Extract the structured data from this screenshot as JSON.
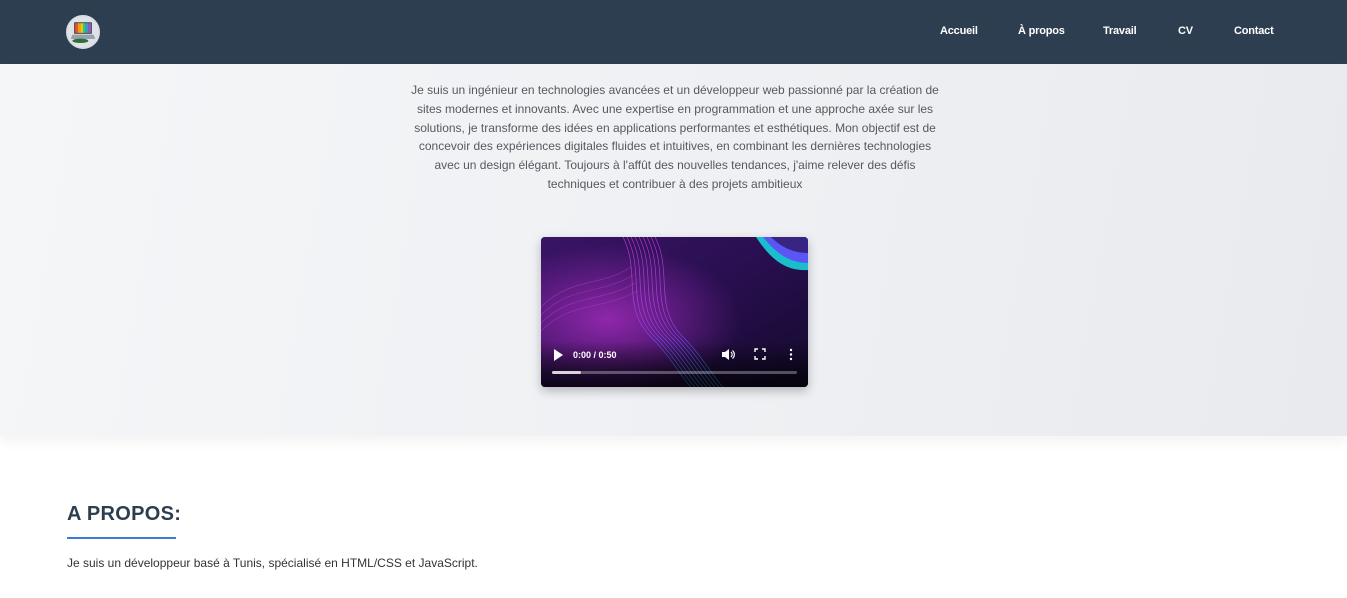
{
  "nav": {
    "logo_icon": "laptop-logo-icon",
    "items": [
      {
        "label": "Accueil"
      },
      {
        "label": "À propos"
      },
      {
        "label": "Travail"
      },
      {
        "label": "CV"
      },
      {
        "label": "Contact"
      }
    ]
  },
  "hero": {
    "description": "Je suis un ingénieur en technologies avancées et un développeur web passionné par la création de sites modernes et innovants. Avec une expertise en programmation et une approche axée sur les solutions, je transforme des idées en applications performantes et esthétiques. Mon objectif est de concevoir des expériences digitales fluides et intuitives, en combinant les dernières technologies avec un design élégant. Toujours à l'affût des nouvelles tendances, j'aime relever des défis techniques et contribuer à des projets ambitieux",
    "video": {
      "time": "0:00 / 0:50",
      "buffered_fraction": 0.12,
      "icons": [
        "play-icon",
        "volume-icon",
        "fullscreen-icon",
        "more-options-icon"
      ]
    }
  },
  "about": {
    "title": "A PROPOS:",
    "text": "Je suis un développeur basé à Tunis, spécialisé en HTML/CSS et JavaScript."
  },
  "colors": {
    "navbar": "#2c3e50",
    "accent": "#3a7bd5",
    "title": "#2c3e50"
  }
}
